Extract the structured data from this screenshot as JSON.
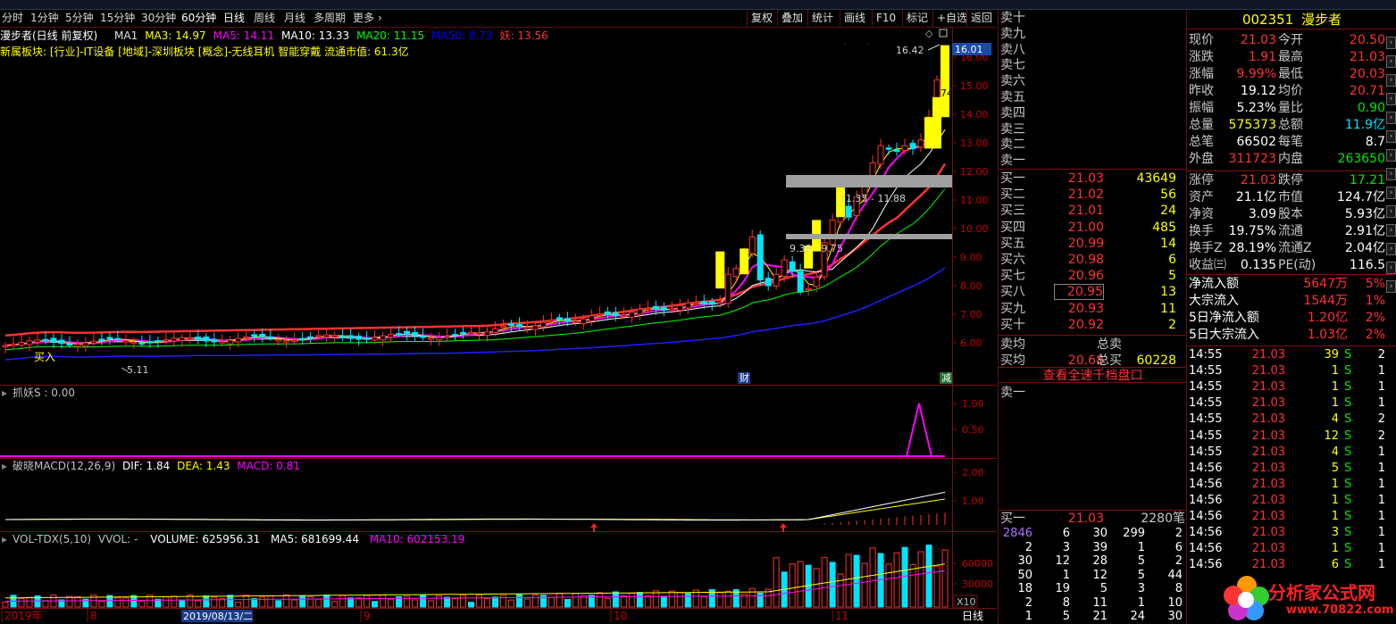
{
  "period_bar": {
    "items": [
      "分时",
      "1分钟",
      "5分钟",
      "15分钟",
      "30分钟",
      "60分钟",
      "日线",
      "周线",
      "月线",
      "多周期",
      "更多"
    ],
    "tools": [
      "复权",
      "叠加",
      "统计",
      "画线",
      "F10",
      "标记",
      "+自选",
      "返回"
    ]
  },
  "main_panel": {
    "title": "漫步者(日线 前复权)",
    "ma_items": [
      {
        "label": "MA1",
        "color": "#e0e0e0"
      },
      {
        "label": "MA3: 14.97",
        "color": "#ffff00"
      },
      {
        "label": "MA5: 14.11",
        "color": "#ff00ff"
      },
      {
        "label": "MA10: 13.33",
        "color": "#ffffff"
      },
      {
        "label": "MA20: 11.15",
        "color": "#00ff00"
      },
      {
        "label": "MA50: 8.73",
        "color": "#0000ff"
      },
      {
        "label": "妖: 13.56",
        "color": "#ff3232"
      }
    ],
    "sector_info": "新属板块: [行业]-IT设备 [地域]-深圳板块 [概念]-无线耳机 智能穿戴 流通市值: 61.3亿",
    "y_ticks": [
      "16.00",
      "15.00",
      "14.00",
      "13.00",
      "12.00",
      "11.00",
      "10.00",
      "9.00",
      "8.00",
      "7.00",
      "6.00"
    ],
    "current_price_tag": "16.01",
    "high_label": "16.42",
    "side_label": "74",
    "zone1_label": "11.35 - 11.88",
    "zone2_label": "9.38 - 9.75",
    "low_label": "5.11",
    "buy_marker": "买入",
    "cai_marker": "财",
    "jian_marker": "减"
  },
  "indicator1": {
    "title": "抓妖S : 0.00",
    "y_ticks": [
      "1.00",
      "0.50"
    ]
  },
  "indicator2": {
    "title": "破晓MACD(12,26,9)",
    "dif": "DIF: 1.84",
    "dea": "DEA: 1.43",
    "macd": "MACD: 0.81",
    "y_ticks": [
      "2.00",
      "1.00"
    ]
  },
  "volume_panel": {
    "title": "VOL-TDX(5,10)",
    "vvol": "VVOL: -",
    "volume": "VOLUME: 625956.31",
    "ma5": "MA5: 681699.44",
    "ma10": "MA10: 602153.19",
    "y_ticks": [
      "60000",
      "30000"
    ],
    "unit": "X10"
  },
  "x_axis": {
    "labels": [
      "2019年",
      "8",
      "9",
      "10",
      "11"
    ],
    "cursor_date": "2019/08/13/二",
    "period": "日线"
  },
  "order_book": {
    "sells": [
      "卖十",
      "卖九",
      "卖八",
      "卖七",
      "卖六",
      "卖五",
      "卖四",
      "卖三",
      "卖二",
      "卖一"
    ],
    "buys": [
      {
        "label": "买一",
        "price": "21.03",
        "vol": "43649"
      },
      {
        "label": "买二",
        "price": "21.02",
        "vol": "56"
      },
      {
        "label": "买三",
        "price": "21.01",
        "vol": "24"
      },
      {
        "label": "买四",
        "price": "21.00",
        "vol": "485"
      },
      {
        "label": "买五",
        "price": "20.99",
        "vol": "14"
      },
      {
        "label": "买六",
        "price": "20.98",
        "vol": "6"
      },
      {
        "label": "买七",
        "price": "20.96",
        "vol": "5"
      },
      {
        "label": "买八",
        "price": "20.95",
        "vol": "13"
      },
      {
        "label": "买九",
        "price": "20.93",
        "vol": "11"
      },
      {
        "label": "买十",
        "price": "20.92",
        "vol": "2"
      }
    ],
    "sell_avg_label": "卖均",
    "buy_avg_label": "买均",
    "buy_avg_price": "20.68",
    "total_sell_label": "总卖",
    "total_buy_label": "总买",
    "total_buy": "60228",
    "view_link": "查看全速千档盘口",
    "queue_sell_label": "卖一",
    "queue_buy_label": "买一",
    "queue_buy_price": "21.03",
    "queue_buy_count": "2280笔",
    "queue_rows": [
      [
        "2846",
        "6",
        "30",
        "299",
        "2"
      ],
      [
        "2",
        "3",
        "39",
        "1",
        "6"
      ],
      [
        "30",
        "12",
        "28",
        "5",
        "2"
      ],
      [
        "50",
        "1",
        "12",
        "5",
        "44"
      ],
      [
        "18",
        "19",
        "5",
        "3",
        "8"
      ],
      [
        "2",
        "8",
        "11",
        "1",
        "10"
      ],
      [
        "1",
        "5",
        "21",
        "24",
        "30"
      ]
    ]
  },
  "quote": {
    "code": "002351",
    "name": "漫步者",
    "rows": [
      {
        "l1": "现价",
        "v1": "21.03",
        "c1": "#ff3232",
        "l2": "今开",
        "v2": "20.50",
        "c2": "#ff3232"
      },
      {
        "l1": "涨跌",
        "v1": "1.91",
        "c1": "#ff3232",
        "l2": "最高",
        "v2": "21.03",
        "c2": "#ff3232"
      },
      {
        "l1": "涨幅",
        "v1": "9.99%",
        "c1": "#ff3232",
        "l2": "最低",
        "v2": "20.03",
        "c2": "#ff3232"
      },
      {
        "l1": "昨收",
        "v1": "19.12",
        "c1": "#ffffff",
        "l2": "均价",
        "v2": "20.71",
        "c2": "#ff3232"
      },
      {
        "l1": "振幅",
        "v1": "5.23%",
        "c1": "#ffffff",
        "l2": "量比",
        "v2": "0.90",
        "c2": "#00e600"
      },
      {
        "l1": "总量",
        "v1": "575373",
        "c1": "#ffff00",
        "l2": "总额",
        "v2": "11.9亿",
        "c2": "#00e5ff"
      },
      {
        "l1": "总笔",
        "v1": "66502",
        "c1": "#ffffff",
        "l2": "每笔",
        "v2": "8.7",
        "c2": "#ffffff"
      },
      {
        "l1": "外盘",
        "v1": "311723",
        "c1": "#ff3232",
        "l2": "内盘",
        "v2": "263650",
        "c2": "#00e600"
      }
    ],
    "rows2": [
      {
        "l1": "涨停",
        "v1": "21.03",
        "c1": "#ff3232",
        "l2": "跌停",
        "v2": "17.21",
        "c2": "#00e600"
      },
      {
        "l1": "资产",
        "v1": "21.1亿",
        "c1": "#ffffff",
        "l2": "市值",
        "v2": "124.7亿",
        "c2": "#ffffff"
      },
      {
        "l1": "净资",
        "v1": "3.09",
        "c1": "#ffffff",
        "l2": "股本",
        "v2": "5.93亿",
        "c2": "#ffffff"
      },
      {
        "l1": "换手",
        "v1": "19.75%",
        "c1": "#ffffff",
        "l2": "流通",
        "v2": "2.91亿",
        "c2": "#ffffff"
      },
      {
        "l1": "换手Z",
        "v1": "28.19%",
        "c1": "#ffffff",
        "l2": "流通Z",
        "v2": "2.04亿",
        "c2": "#ffffff"
      },
      {
        "l1": "收益㈢",
        "v1": "0.135",
        "c1": "#ffffff",
        "l2": "PE(动)",
        "v2": "116.5",
        "c2": "#ffffff"
      }
    ],
    "flows": [
      {
        "label": "净流入额",
        "val": "5647万",
        "pct": "5%"
      },
      {
        "label": "大宗流入",
        "val": "1544万",
        "pct": "1%"
      },
      {
        "label": "5日净流入额",
        "val": "1.20亿",
        "pct": "2%"
      },
      {
        "label": "5日大宗流入",
        "val": "1.03亿",
        "pct": "2%"
      }
    ],
    "ticks": [
      {
        "time": "14:55",
        "price": "21.03",
        "vol": "39",
        "side": "S",
        "n": "2"
      },
      {
        "time": "14:55",
        "price": "21.03",
        "vol": "1",
        "side": "S",
        "n": "1"
      },
      {
        "time": "14:55",
        "price": "21.03",
        "vol": "1",
        "side": "S",
        "n": "1"
      },
      {
        "time": "14:55",
        "price": "21.03",
        "vol": "1",
        "side": "S",
        "n": "1"
      },
      {
        "time": "14:55",
        "price": "21.03",
        "vol": "4",
        "side": "S",
        "n": "2"
      },
      {
        "time": "14:55",
        "price": "21.03",
        "vol": "12",
        "side": "S",
        "n": "2"
      },
      {
        "time": "14:55",
        "price": "21.03",
        "vol": "4",
        "side": "S",
        "n": "1"
      },
      {
        "time": "14:56",
        "price": "21.03",
        "vol": "5",
        "side": "S",
        "n": "1"
      },
      {
        "time": "14:56",
        "price": "21.03",
        "vol": "1",
        "side": "S",
        "n": "1"
      },
      {
        "time": "14:56",
        "price": "21.03",
        "vol": "1",
        "side": "S",
        "n": "1"
      },
      {
        "time": "14:56",
        "price": "21.03",
        "vol": "1",
        "side": "S",
        "n": "1"
      },
      {
        "time": "14:56",
        "price": "21.03",
        "vol": "3",
        "side": "S",
        "n": "1"
      },
      {
        "time": "14:56",
        "price": "21.03",
        "vol": "1",
        "side": "S",
        "n": "1"
      },
      {
        "time": "14:56",
        "price": "21.03",
        "vol": "6",
        "side": "S",
        "n": "1"
      }
    ]
  },
  "watermark": {
    "title": "分析家公式网",
    "url": "www.70822.com"
  }
}
